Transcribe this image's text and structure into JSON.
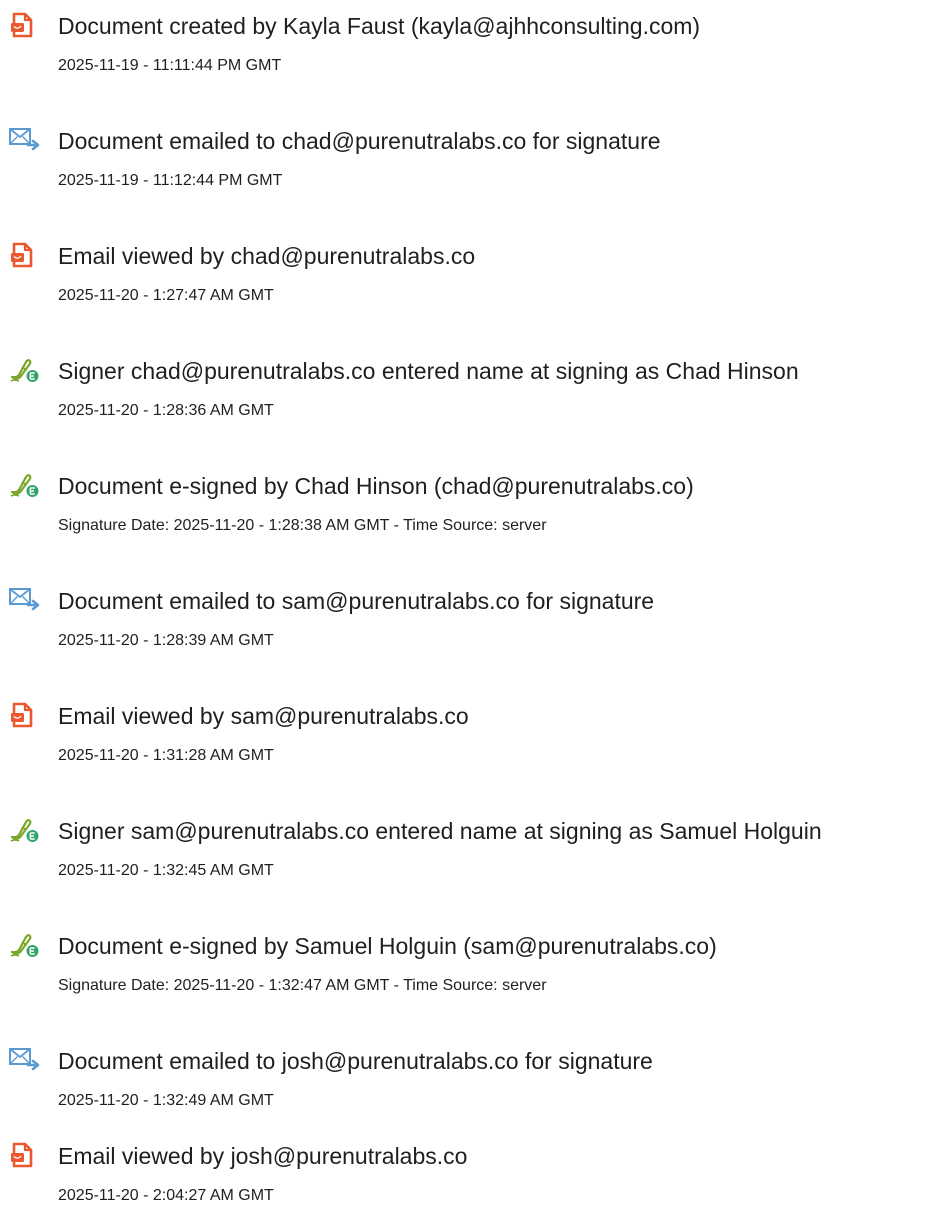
{
  "colors": {
    "doc_icon": "#e9582e",
    "email_icon": "#5b9bd5",
    "sign_icon_pen": "#7aa62a",
    "sign_icon_badge": "#33a56b",
    "text": "#1f1f1f"
  },
  "events": [
    {
      "icon": "document-icon",
      "title": "Document created by Kayla Faust (kayla@ajhhconsulting.com)",
      "date": "2025-11-19 - 11:11:44 PM GMT"
    },
    {
      "icon": "email-icon",
      "title": "Document emailed to chad@purenutralabs.co for signature",
      "date": "2025-11-19 - 11:12:44 PM GMT"
    },
    {
      "icon": "document-icon",
      "title": "Email viewed by chad@purenutralabs.co",
      "date": "2025-11-20 - 1:27:47 AM GMT"
    },
    {
      "icon": "signature-icon",
      "title": "Signer chad@purenutralabs.co entered name at signing as Chad Hinson",
      "date": "2025-11-20 - 1:28:36 AM GMT"
    },
    {
      "icon": "signature-icon",
      "title": "Document e-signed by Chad Hinson (chad@purenutralabs.co)",
      "date": "Signature Date: 2025-11-20 - 1:28:38 AM GMT - Time Source: server"
    },
    {
      "icon": "email-icon",
      "title": "Document emailed to sam@purenutralabs.co for signature",
      "date": "2025-11-20 - 1:28:39 AM GMT"
    },
    {
      "icon": "document-icon",
      "title": "Email viewed by sam@purenutralabs.co",
      "date": "2025-11-20 - 1:31:28 AM GMT"
    },
    {
      "icon": "signature-icon",
      "title": "Signer sam@purenutralabs.co entered name at signing as Samuel Holguin",
      "date": "2025-11-20 - 1:32:45 AM GMT"
    },
    {
      "icon": "signature-icon",
      "title": "Document e-signed by Samuel Holguin (sam@purenutralabs.co)",
      "date": "Signature Date: 2025-11-20 - 1:32:47 AM GMT - Time Source: server"
    },
    {
      "icon": "email-icon",
      "title": "Document emailed to josh@purenutralabs.co for signature",
      "date": "2025-11-20 - 1:32:49 AM GMT"
    },
    {
      "icon": "document-icon",
      "title": "Email viewed by josh@purenutralabs.co",
      "date": "2025-11-20 - 2:04:27 AM GMT"
    }
  ]
}
